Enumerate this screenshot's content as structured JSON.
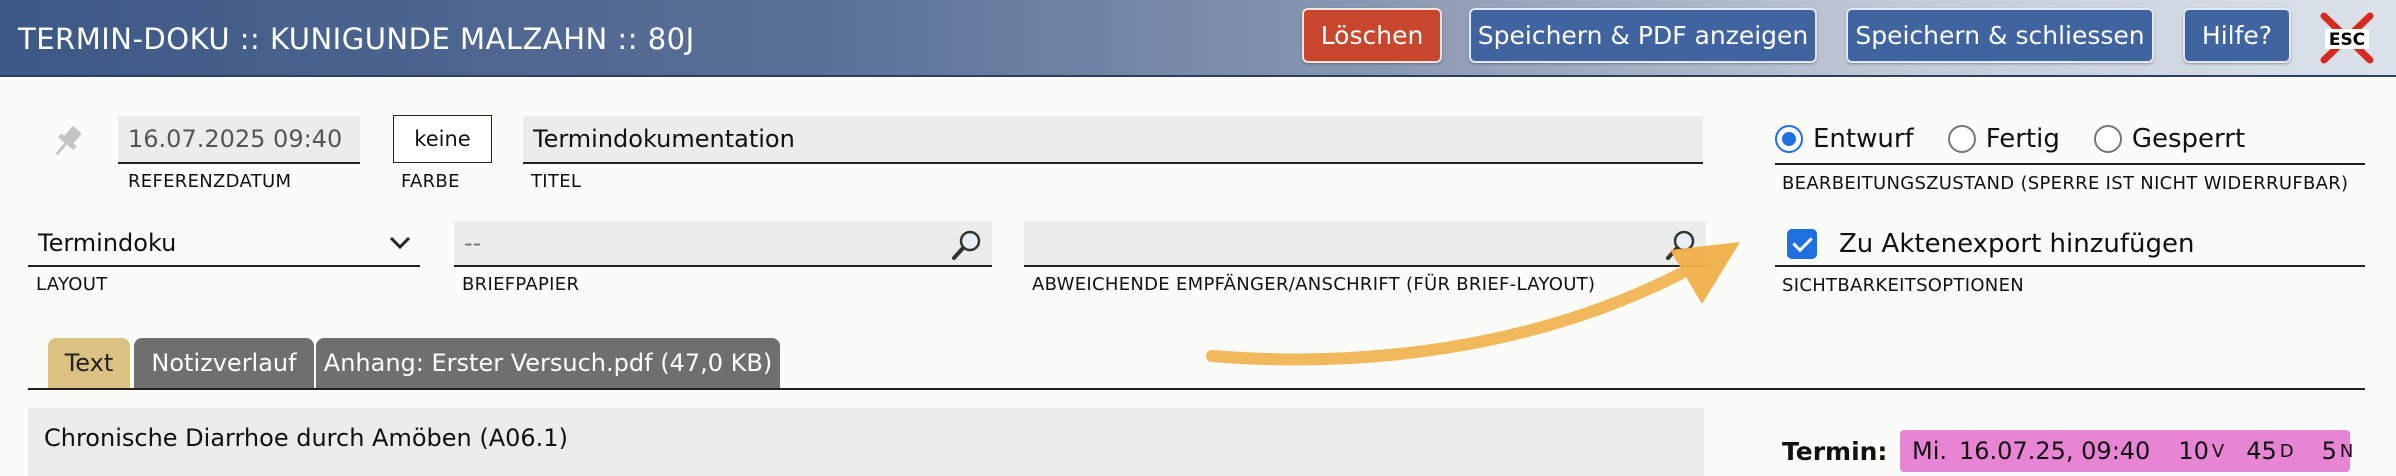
{
  "header": {
    "title": "TERMIN-DOKU :: KUNIGUNDE MALZAHN :: 80J",
    "buttons": {
      "delete": "Löschen",
      "save_pdf": "Speichern & PDF anzeigen",
      "save_close": "Speichern & schliessen",
      "help": "Hilfe?"
    },
    "esc_icon": "ESC"
  },
  "form": {
    "reference_date": {
      "value": "16.07.2025 09:40",
      "label": "REFERENZDATUM"
    },
    "color": {
      "value": "keine",
      "label": "FARBE"
    },
    "title": {
      "value": "Termindokumentation",
      "label": "TITEL"
    },
    "status": {
      "options": [
        "Entwurf",
        "Fertig",
        "Gesperrt"
      ],
      "selected": "Entwurf",
      "label": "BEARBEITUNGSZUSTAND (SPERRE IST NICHT WIDERRUFBAR)"
    },
    "layout": {
      "value": "Termindoku",
      "label": "LAYOUT"
    },
    "letterhead": {
      "value": "--",
      "label": "BRIEFPAPIER"
    },
    "recipient": {
      "value": "",
      "label": "ABWEICHENDE EMPFÄNGER/ANSCHRIFT (FÜR BRIEF-LAYOUT)"
    },
    "visibility": {
      "checkbox_label": "Zu Aktenexport hinzufügen",
      "checked": true,
      "label": "SICHTBARKEITSOPTIONEN"
    }
  },
  "tabs": [
    {
      "label": "Text",
      "active": true
    },
    {
      "label": "Notizverlauf",
      "active": false
    },
    {
      "label": "Anhang: Erster Versuch.pdf (47,0 KB)",
      "active": false
    }
  ],
  "content": {
    "diagnosis": "Chronische Diarrhoe durch Amöben (A06.1)"
  },
  "appointment": {
    "label": "Termin:",
    "day": "Mi.",
    "datetime": "16.07.25, 09:40",
    "v_count": "10",
    "v_unit": "V",
    "d_count": "45",
    "d_unit": "D",
    "n_count": "5",
    "n_unit": "N"
  },
  "colors": {
    "header_start": "#3c5885",
    "delete_button": "#c8462c",
    "primary_button": "#3f64a0",
    "active_tab": "#dcc282",
    "inactive_tab": "#6f6f6f",
    "appointment_badge": "#e784d3",
    "accent": "#1e6fe0",
    "annotation_arrow": "#f0b04a"
  },
  "icons": [
    "pin-icon",
    "chevron-down-icon",
    "search-icon",
    "esc-close-icon",
    "annotation-arrow"
  ]
}
